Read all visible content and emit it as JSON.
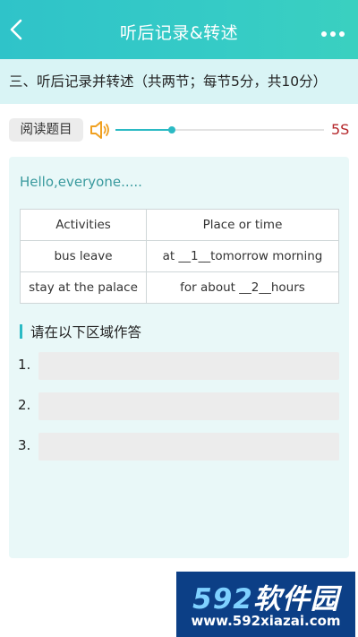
{
  "header": {
    "title": "听后记录&转述",
    "back_icon": "chevron-left-icon",
    "more_icon": "more-dots-icon"
  },
  "section": {
    "label": "三、听后记录并转述（共两节；每节5分，共10分）"
  },
  "audio": {
    "read_button": "阅读题目",
    "speaker_icon": "speaker-icon",
    "progress_fraction": 0.27,
    "timer": "5S",
    "accent_color": "#2bbac4",
    "timer_color": "#b5262a"
  },
  "passage": {
    "intro": "Hello,everyone.....",
    "table": {
      "headers": [
        "Activities",
        "Place or time"
      ],
      "rows": [
        [
          "bus leave",
          "at __1__tomorrow morning"
        ],
        [
          "stay at the palace",
          "for about __2__hours"
        ]
      ]
    }
  },
  "answer": {
    "heading": "请在以下区域作答",
    "items": [
      {
        "num": "1.",
        "value": ""
      },
      {
        "num": "2.",
        "value": ""
      },
      {
        "num": "3.",
        "value": ""
      }
    ]
  },
  "watermark": {
    "brand_num": "592",
    "brand_text": "软件园",
    "url": "www.592xiazai.com"
  }
}
